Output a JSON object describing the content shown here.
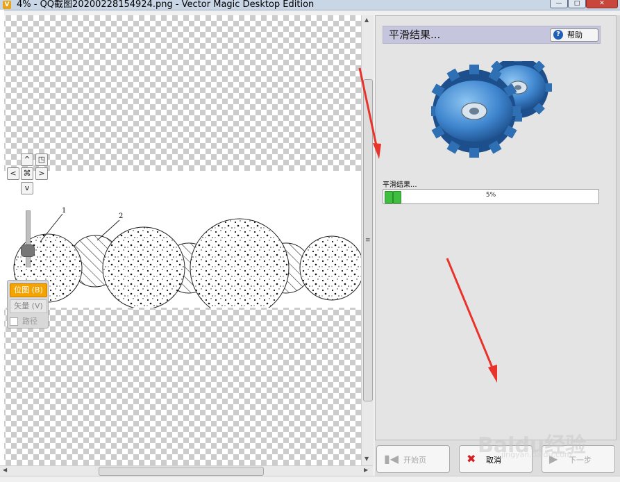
{
  "window": {
    "title": "4% - QQ截图20200228154924.png - Vector Magic Desktop Edition",
    "controls": {
      "minimize": "—",
      "maximize": "□",
      "close": "✕"
    }
  },
  "canvas": {
    "nav": {
      "up": "^",
      "down": "v",
      "left": "<",
      "right": ">",
      "center": "⌘",
      "fit": "◳"
    },
    "drawing_labels": [
      "1",
      "2"
    ],
    "modes": {
      "bitmap": "位图 (B)",
      "vector": "矢量 (V)",
      "paths": "路径"
    }
  },
  "panel": {
    "header_title": "平滑结果...",
    "help_label": "帮助",
    "progress_label": "平滑结果...",
    "progress_text": "5%",
    "progress_value": 0.05
  },
  "buttons": {
    "start_page": "开始页",
    "cancel": "取消",
    "next": "下一步"
  },
  "watermark": {
    "brand": "Baidu经验",
    "sub": "jingyan.baidu.com"
  },
  "colors": {
    "accent": "#f5a300",
    "progress": "#3fbf3f",
    "arrow": "#e8322a",
    "header": "#c5c5dd"
  }
}
